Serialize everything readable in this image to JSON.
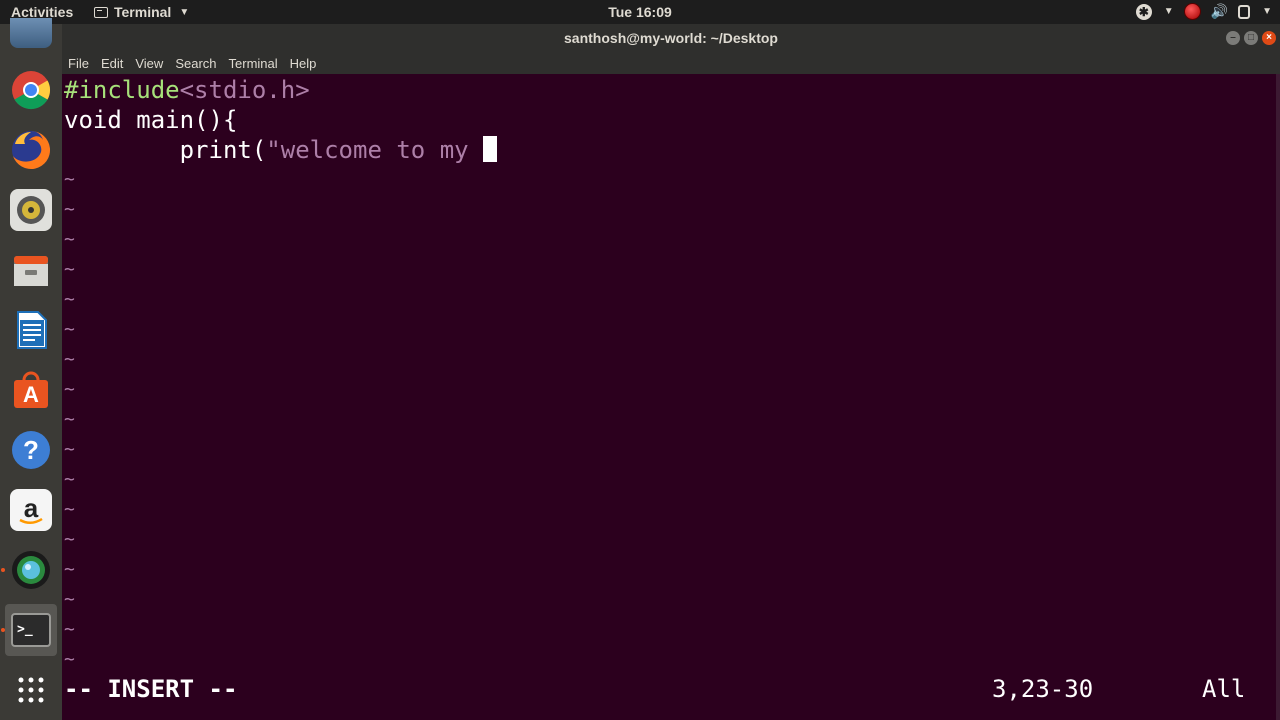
{
  "topbar": {
    "activities": "Activities",
    "app_name": "Terminal",
    "clock": "Tue 16:09"
  },
  "window": {
    "title": "santhosh@my-world: ~/Desktop",
    "menu": [
      "File",
      "Edit",
      "View",
      "Search",
      "Terminal",
      "Help"
    ]
  },
  "editor": {
    "line1_directive": "#include",
    "line1_header": "<stdio.h>",
    "line2": "void main(){",
    "line3_indent": "        ",
    "line3_func": "print(",
    "line3_string": "\"welcome to my ",
    "tilde": "~",
    "tilde_count": 17
  },
  "status": {
    "mode": "-- INSERT --",
    "position": "3,23-30",
    "scroll": "All"
  },
  "launcher": {
    "apps": [
      "chrome-icon",
      "firefox-icon",
      "rhythmbox-icon",
      "files-icon",
      "libreoffice-writer-icon",
      "software-center-icon",
      "help-icon",
      "amazon-icon",
      "app-icon",
      "terminal-icon",
      "show-apps-icon"
    ]
  }
}
